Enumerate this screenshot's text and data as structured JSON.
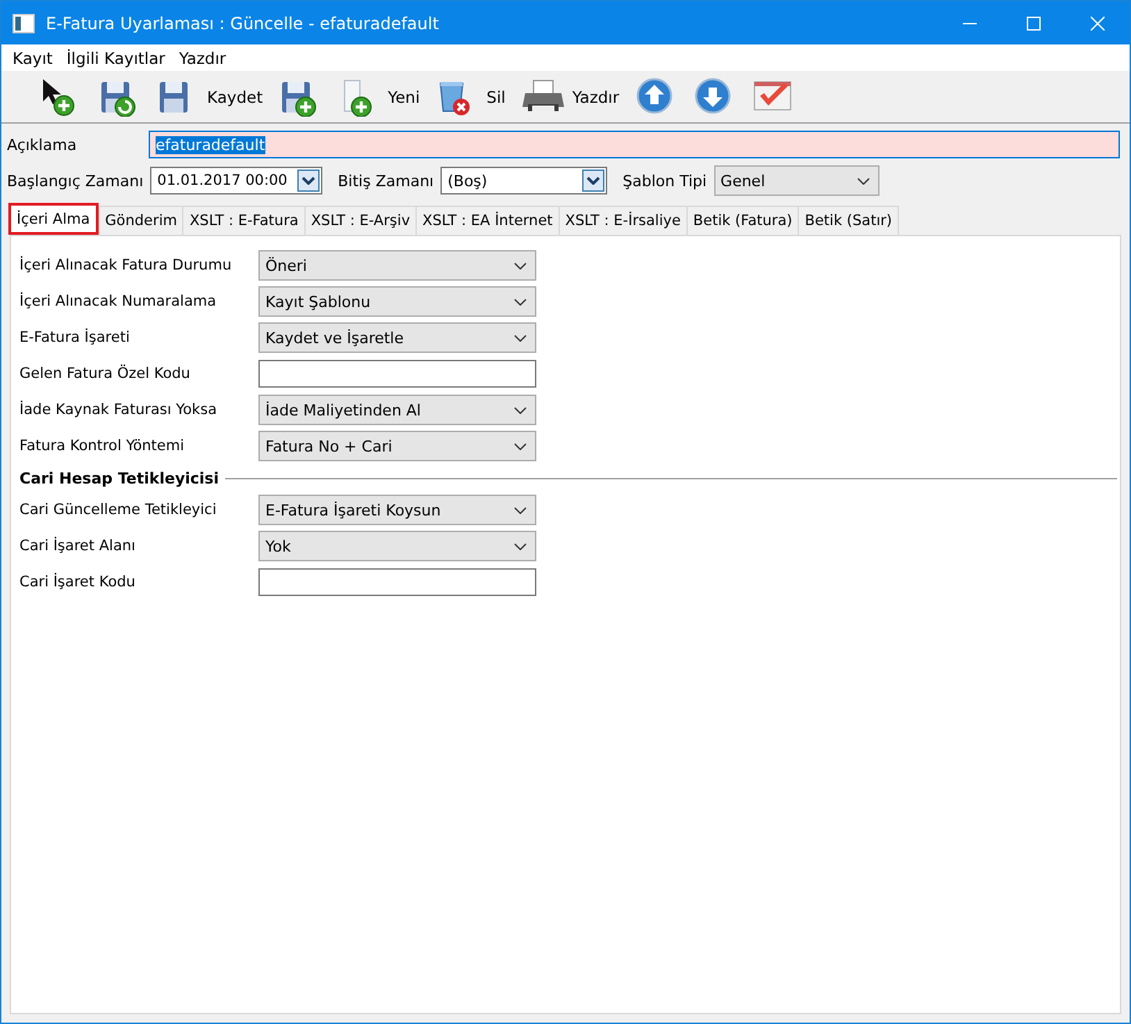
{
  "window": {
    "title": "E-Fatura Uyarlaması : Güncelle - efaturadefault"
  },
  "menu": [
    {
      "label": "Kayıt"
    },
    {
      "label": "İlgili Kayıtlar"
    },
    {
      "label": "Yazdır"
    }
  ],
  "toolbar": [
    {
      "kind": "add"
    },
    {
      "kind": "save-undo"
    },
    {
      "kind": "save",
      "label": "Kaydet"
    },
    {
      "kind": "save-add"
    },
    {
      "kind": "new",
      "label": "Yeni"
    },
    {
      "kind": "delete",
      "label": "Sil"
    },
    {
      "kind": "print",
      "label": "Yazdır"
    },
    {
      "kind": "up"
    },
    {
      "kind": "down"
    },
    {
      "kind": "check"
    }
  ],
  "description": {
    "label": "Açıklama",
    "value": "efaturadefault",
    "highlighted": true
  },
  "filters": [
    {
      "kind": "date",
      "label": "Başlangıç Zamanı",
      "value": "01.01.2017 00:00"
    },
    {
      "kind": "date",
      "label": "Bitiş Zamanı",
      "value": "(Boş)"
    },
    {
      "kind": "combo",
      "label": "Şablon Tipi",
      "value": "Genel"
    }
  ],
  "tabs": [
    {
      "label": "İçeri Alma",
      "selected": true
    },
    {
      "label": "Gönderim",
      "selected": false
    },
    {
      "label": "XSLT : E-Fatura",
      "selected": false
    },
    {
      "label": "XSLT : E-Arşiv",
      "selected": false
    },
    {
      "label": "XSLT : EA İnternet",
      "selected": false
    },
    {
      "label": "XSLT : E-İrsaliye",
      "selected": false
    },
    {
      "label": "Betik (Fatura)",
      "selected": false
    },
    {
      "label": "Betik (Satır)",
      "selected": false
    }
  ],
  "form": [
    {
      "kind": "select",
      "label": "İçeri Alınacak Fatura Durumu",
      "value": "Öneri"
    },
    {
      "kind": "select",
      "label": "İçeri Alınacak Numaralama",
      "value": "Kayıt Şablonu"
    },
    {
      "kind": "select",
      "label": "E-Fatura İşareti",
      "value": "Kaydet ve İşaretle"
    },
    {
      "kind": "text",
      "label": "Gelen Fatura Özel Kodu"
    },
    {
      "kind": "select",
      "label": "İade Kaynak Faturası Yoksa",
      "value": "İade Maliyetinden Al"
    },
    {
      "kind": "select",
      "label": "Fatura Kontrol Yöntemi",
      "value": "Fatura No + Cari"
    },
    {
      "kind": "section",
      "label": "Cari Hesap Tetikleyicisi"
    },
    {
      "kind": "select",
      "label": "Cari Güncelleme Tetikleyici",
      "value": "E-Fatura İşareti Koysun"
    },
    {
      "kind": "select",
      "label": "Cari İşaret Alanı",
      "value": "Yok"
    },
    {
      "kind": "text",
      "label": "Cari İşaret Kodu"
    }
  ]
}
